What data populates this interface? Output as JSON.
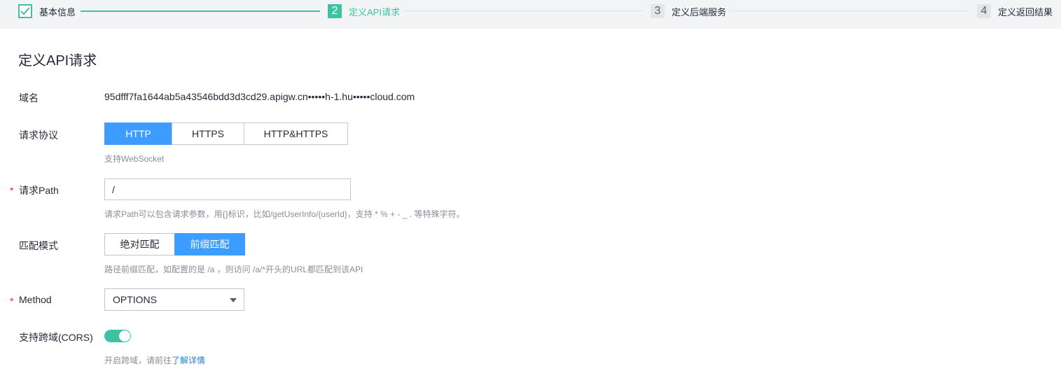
{
  "stepper": {
    "steps": [
      {
        "number": "",
        "label": "基本信息",
        "state": "done",
        "icon": "check-icon"
      },
      {
        "number": "2",
        "label": "定义API请求",
        "state": "active"
      },
      {
        "number": "3",
        "label": "定义后端服务",
        "state": "pending"
      },
      {
        "number": "4",
        "label": "定义返回结果",
        "state": "pending"
      }
    ]
  },
  "section_title": "定义API请求",
  "domain": {
    "label": "域名",
    "value": "95dfff7fa1644ab5a43546bdd3d3cd29.apigw.cn•••••h-1.hu•••••cloud.com"
  },
  "protocol": {
    "label": "请求协议",
    "options": [
      "HTTP",
      "HTTPS",
      "HTTP&HTTPS"
    ],
    "selected": "HTTP",
    "hint": "支持WebSocket"
  },
  "path": {
    "required_mark": "*",
    "label": "请求Path",
    "value": "/",
    "hint": "请求Path可以包含请求参数，用{}标识，比如/getUserInfo/{userId}，支持 * % + - _ . 等特殊字符。"
  },
  "match_mode": {
    "label": "匹配模式",
    "options": [
      "绝对匹配",
      "前缀匹配"
    ],
    "selected": "前缀匹配",
    "hint": "路径前缀匹配，如配置的是 /a ，则访问 /a/*开头的URL都匹配到该API"
  },
  "method": {
    "required_mark": "*",
    "label": "Method",
    "value": "OPTIONS"
  },
  "cors": {
    "label": "支持跨域(CORS)",
    "enabled": true,
    "hint_prefix": "开启跨域，请前往",
    "hint_link": "了解详情"
  },
  "colors": {
    "accent_green": "#3fc2a2",
    "accent_blue": "#3c9cff",
    "required_red": "#f5222d",
    "link_blue": "#1e7fd6"
  }
}
